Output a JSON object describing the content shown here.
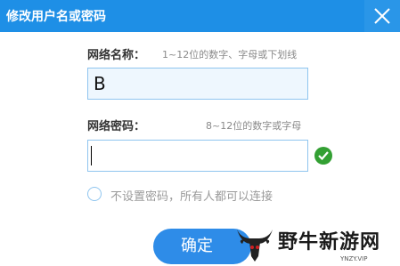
{
  "dialog": {
    "title": "修改用户名或密码"
  },
  "network_name": {
    "label": "网络名称：",
    "hint": "1~12位的数字、字母或下划线",
    "value": "B"
  },
  "network_password": {
    "label": "网络密码：",
    "hint": "8~12位的数字或字母",
    "value": ""
  },
  "no_password": {
    "label": "不设置密码，所有人都可以连接",
    "checked": false
  },
  "confirm_label": "确定",
  "watermark": {
    "text": "野牛新游网",
    "url": "YNZY.VIP"
  },
  "colors": {
    "titlebar": "#1e8fe6",
    "accent": "#2e8ce8",
    "valid": "#33a033"
  }
}
